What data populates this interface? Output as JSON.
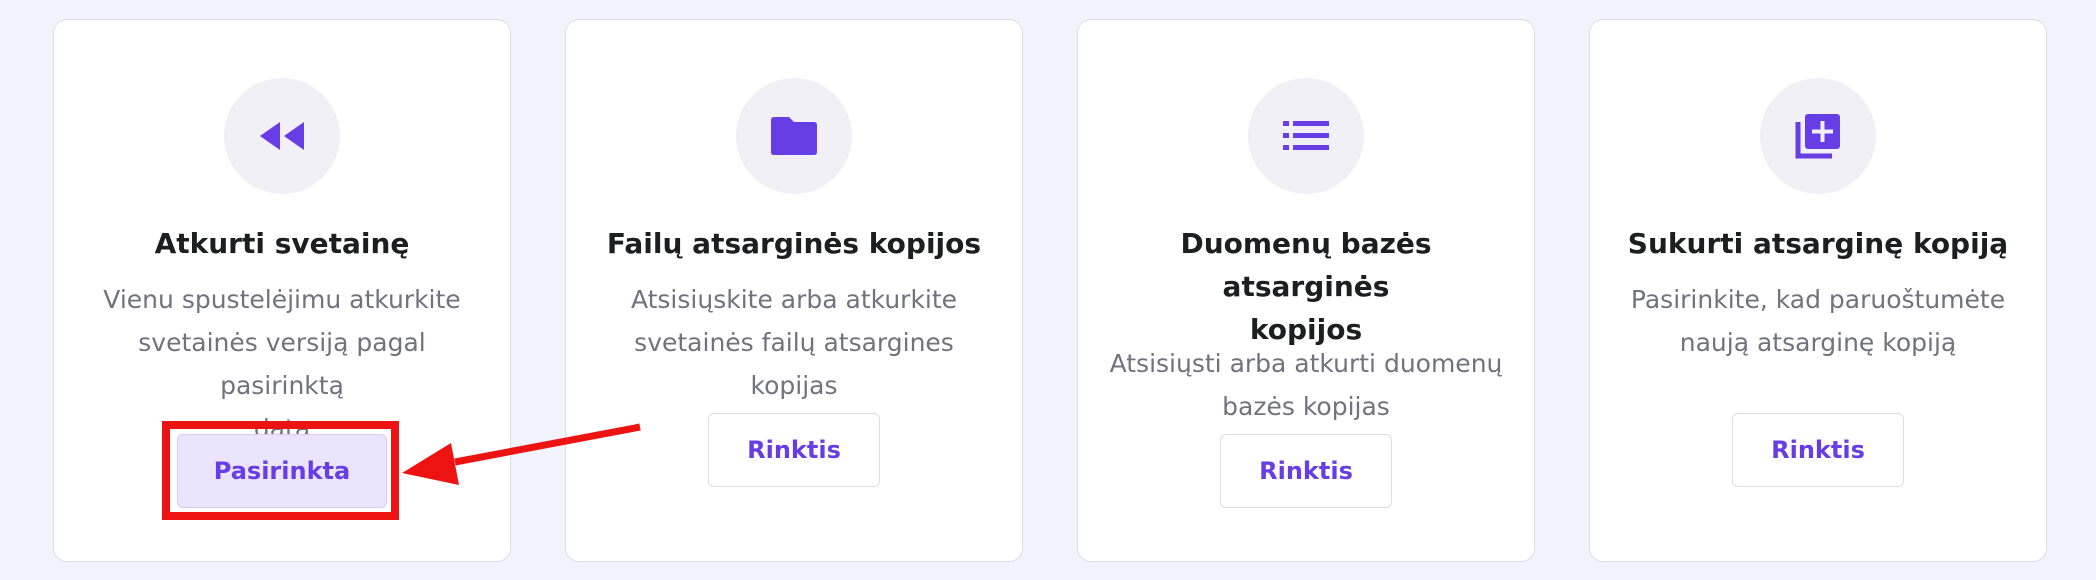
{
  "cards": [
    {
      "icon": "rewind-icon",
      "title": "Atkurti svetainę",
      "description_lines": [
        "Vienu spustelėjimu atkurkite",
        "svetainės versiją pagal pasirinktą",
        "datą"
      ],
      "button_label": "Pasirinkta",
      "button_state": "selected"
    },
    {
      "icon": "folder-icon",
      "title": "Failų atsarginės kopijos",
      "description_lines": [
        "Atsisiųskite arba atkurkite",
        "svetainės failų atsargines kopijas"
      ],
      "button_label": "Rinktis",
      "button_state": "default"
    },
    {
      "icon": "list-icon",
      "title_lines": [
        "Duomenų bazės atsarginės",
        "kopijos"
      ],
      "description_lines": [
        "Atsisiųsti arba atkurti duomenų",
        "bazės kopijas"
      ],
      "button_label": "Rinktis",
      "button_state": "default"
    },
    {
      "icon": "add-copy-icon",
      "title": "Sukurti atsarginę kopiją",
      "description_lines": [
        "Pasirinkite, kad paruoštumėte",
        "naują atsarginę kopiją"
      ],
      "button_label": "Rinktis",
      "button_state": "default"
    }
  ],
  "colors": {
    "background": "#f3f3fd",
    "accent": "#673de6",
    "selected_button_bg": "#ebe4ff",
    "annotation": "#ee1313",
    "title_text": "#1d1e20",
    "description_text": "#72727f"
  },
  "annotation": {
    "type": "red-box-and-arrow",
    "target": "Pasirinkta"
  }
}
